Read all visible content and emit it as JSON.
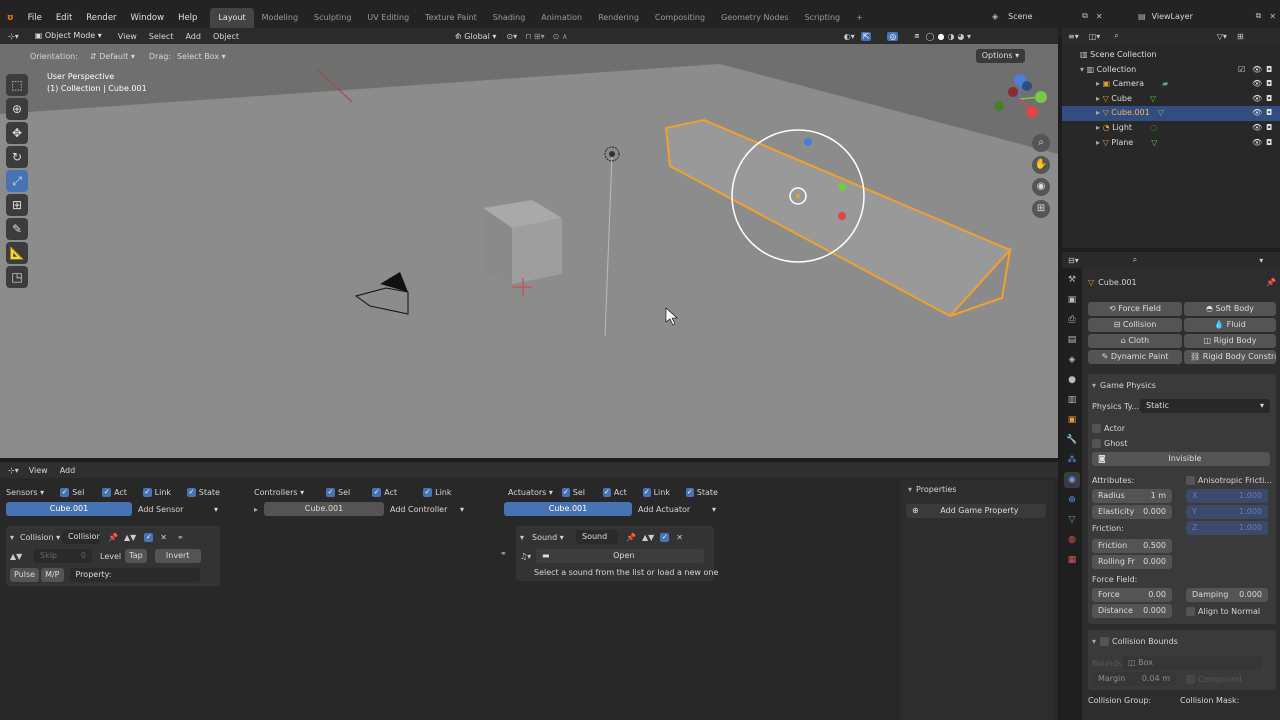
{
  "menu": [
    "File",
    "Edit",
    "Render",
    "Window",
    "Help"
  ],
  "workspaces": [
    "Layout",
    "Modeling",
    "Sculpting",
    "UV Editing",
    "Texture Paint",
    "Shading",
    "Animation",
    "Rendering",
    "Compositing",
    "Geometry Nodes",
    "Scripting"
  ],
  "scene": {
    "label": "Scene",
    "viewlayer": "ViewLayer"
  },
  "viewport_header": {
    "mode": "Object Mode",
    "view": "View",
    "select": "Select",
    "add": "Add",
    "object": "Object",
    "orientation_global": "Global"
  },
  "tool_settings": {
    "orientation_label": "Orientation:",
    "orientation_value": "Default",
    "drag_label": "Drag:",
    "drag_value": "Select Box",
    "options": "Options"
  },
  "overlay_text": {
    "perspective": "User Perspective",
    "collection": "(1) Collection | Cube.001"
  },
  "outliner": {
    "root": "Scene Collection",
    "collection": "Collection",
    "items": [
      {
        "name": "Camera"
      },
      {
        "name": "Cube"
      },
      {
        "name": "Cube.001"
      },
      {
        "name": "Light"
      },
      {
        "name": "Plane"
      }
    ]
  },
  "properties": {
    "object_name": "Cube.001",
    "physics_buttons": [
      [
        "Force Field",
        "Soft Body"
      ],
      [
        "Collision",
        "Fluid"
      ],
      [
        "Cloth",
        "Rigid Body"
      ],
      [
        "Dynamic Paint",
        "Rigid Body Constra..."
      ]
    ],
    "game_physics": "Game Physics",
    "physics_type_label": "Physics Ty...",
    "physics_type_value": "Static",
    "actor": "Actor",
    "ghost": "Ghost",
    "invisible": "Invisible",
    "attributes": "Attributes:",
    "aniso": "Anisotropic Fricti...",
    "radius_label": "Radius",
    "radius_value": "1 m",
    "elasticity_label": "Elasticity",
    "elasticity_value": "0.000",
    "aniso_x": "1.000",
    "aniso_y": "1.000",
    "aniso_z": "1.000",
    "ax_x": "X",
    "ax_y": "Y",
    "ax_z": "Z",
    "friction": "Friction:",
    "friction_label": "Friction",
    "friction_value": "0.500",
    "rolling_label": "Rolling Fr",
    "rolling_value": "0.000",
    "force_field": "Force Field:",
    "force_label": "Force",
    "force_value": "0.00",
    "damping_label": "Damping",
    "damping_value": "0.000",
    "distance_label": "Distance",
    "distance_value": "0.000",
    "align_normal": "Align to Normal",
    "collision_bounds": "Collision Bounds",
    "bounds_label": "Bounds",
    "bounds_value": "Box",
    "margin_label": "Margin",
    "margin_value": "0.04 m",
    "compound": "Compound",
    "collision_group": "Collision Group:",
    "collision_mask": "Collision Mask:"
  },
  "logic": {
    "view": "View",
    "add": "Add",
    "sensors": "Sensors",
    "controllers": "Controllers",
    "actuators": "Actuators",
    "sel": "Sel",
    "act": "Act",
    "link": "Link",
    "state": "State",
    "obj": "Cube.001",
    "add_sensor": "Add Sensor",
    "add_controller": "Add Controller",
    "add_actuator": "Add Actuator",
    "sensor_type": "Collision",
    "sensor_name": "Collision",
    "skip": "Skip",
    "skip_val": "0",
    "level": "Level",
    "tap": "Tap",
    "invert": "Invert",
    "pulse": "Pulse",
    "mp": "M/P",
    "property": "Property:",
    "act_type": "Sound",
    "act_name": "Sound",
    "open": "Open",
    "act_help": "Select a sound from the list or load a new one",
    "properties_title": "Properties",
    "add_game_property": "Add Game Property"
  }
}
